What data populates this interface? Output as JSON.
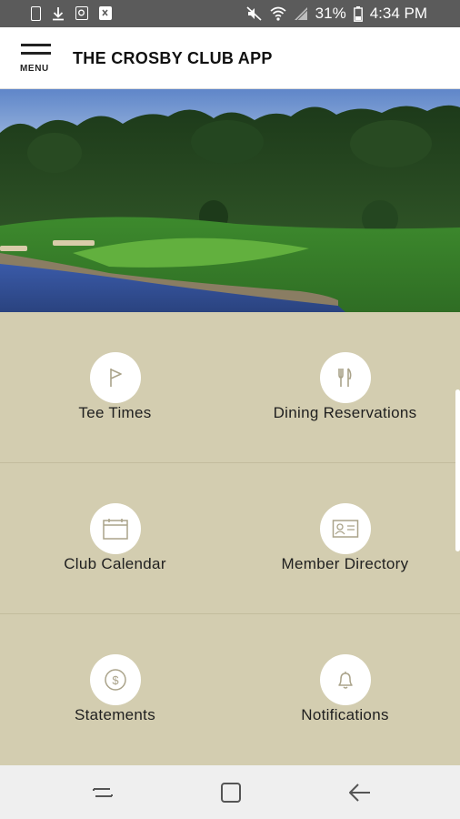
{
  "status_bar": {
    "battery": "31%",
    "time": "4:34 PM",
    "icons": [
      "phone-icon",
      "download-icon",
      "image-icon",
      "app-icon",
      "mute-icon",
      "wifi-icon",
      "signal-icon",
      "battery-icon"
    ]
  },
  "app_bar": {
    "menu_label": "MENU",
    "title": "THE CROSBY CLUB APP"
  },
  "hero": {
    "description": "golf-course-image"
  },
  "tiles": [
    {
      "label": "Tee Times",
      "icon": "flag-icon"
    },
    {
      "label": "Dining Reservations",
      "icon": "utensils-icon"
    },
    {
      "label": "Club Calendar",
      "icon": "calendar-icon"
    },
    {
      "label": "Member Directory",
      "icon": "id-card-icon"
    },
    {
      "label": "Statements",
      "icon": "dollar-icon"
    },
    {
      "label": "Notifications",
      "icon": "bell-icon"
    }
  ],
  "nav_bar": {
    "buttons": [
      "recents-button",
      "home-button",
      "back-button"
    ]
  },
  "colors": {
    "tile_bg": "#d3cdb0",
    "status_bg": "#5b5b5b",
    "icon_stroke": "#aaa38a"
  }
}
